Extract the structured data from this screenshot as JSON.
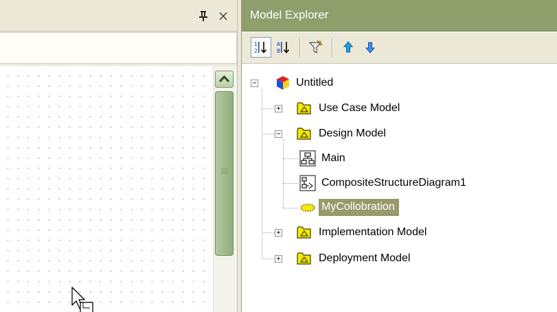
{
  "left_panel": {
    "pin_icon": "pin-icon",
    "close_label": "×"
  },
  "model_explorer": {
    "title": "Model Explorer",
    "toolbar": {
      "buttons": [
        {
          "name": "sort-by-order",
          "icon": "sort-numeric-icon"
        },
        {
          "name": "sort-by-name",
          "icon": "sort-alpha-icon"
        },
        {
          "name": "filter",
          "icon": "filter-icon"
        },
        {
          "name": "move-up",
          "icon": "arrow-up-icon",
          "color": "#0a9ee8"
        },
        {
          "name": "move-down",
          "icon": "arrow-down-icon",
          "color": "#2f7be0"
        }
      ]
    },
    "tree": {
      "root": {
        "label": "Untitled",
        "expanded": true
      },
      "items": [
        {
          "label": "Use Case Model",
          "expanded": false
        },
        {
          "label": "Design Model",
          "expanded": true
        },
        {
          "label": "Main"
        },
        {
          "label": "CompositeStructureDiagram1"
        },
        {
          "label": "MyCollobration",
          "selected": true
        },
        {
          "label": "Implementation Model",
          "expanded": false
        },
        {
          "label": "Deployment Model",
          "expanded": false
        }
      ]
    }
  },
  "colors": {
    "title_bar": "#8e9f6c",
    "selection": "#999a6c",
    "folder_yellow": "#f5e800"
  }
}
